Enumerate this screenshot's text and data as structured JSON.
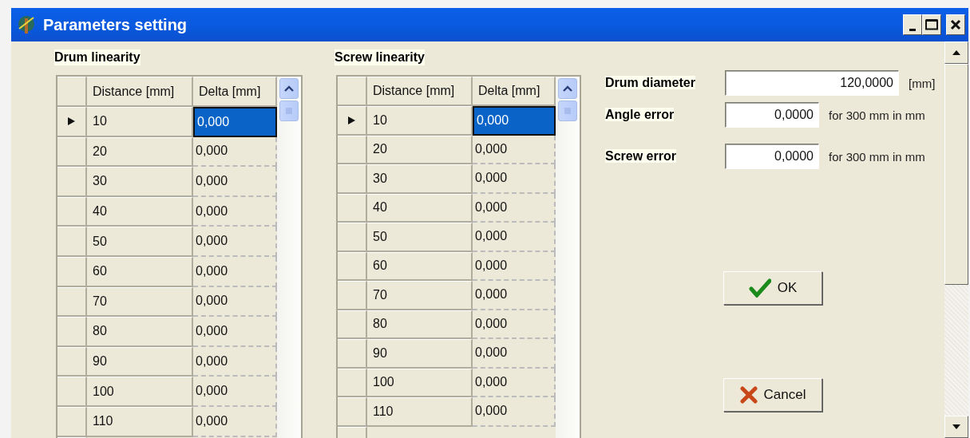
{
  "window": {
    "title": "Parameters setting"
  },
  "tables": [
    {
      "title": "Drum linearity",
      "columns": [
        "Distance [mm]",
        "Delta [mm]"
      ],
      "rows": [
        {
          "distance": "10",
          "delta": "0,000",
          "selected": true
        },
        {
          "distance": "20",
          "delta": "0,000",
          "selected": false
        },
        {
          "distance": "30",
          "delta": "0,000",
          "selected": false
        },
        {
          "distance": "40",
          "delta": "0,000",
          "selected": false
        },
        {
          "distance": "50",
          "delta": "0,000",
          "selected": false
        },
        {
          "distance": "60",
          "delta": "0,000",
          "selected": false
        },
        {
          "distance": "70",
          "delta": "0,000",
          "selected": false
        },
        {
          "distance": "80",
          "delta": "0,000",
          "selected": false
        },
        {
          "distance": "90",
          "delta": "0,000",
          "selected": false
        },
        {
          "distance": "100",
          "delta": "0,000",
          "selected": false
        },
        {
          "distance": "110",
          "delta": "0,000",
          "selected": false
        }
      ]
    },
    {
      "title": "Screw linearity",
      "columns": [
        "Distance [mm]",
        "Delta [mm]"
      ],
      "rows": [
        {
          "distance": "10",
          "delta": "0,000",
          "selected": true
        },
        {
          "distance": "20",
          "delta": "0,000",
          "selected": false
        },
        {
          "distance": "30",
          "delta": "0,000",
          "selected": false
        },
        {
          "distance": "40",
          "delta": "0,000",
          "selected": false
        },
        {
          "distance": "50",
          "delta": "0,000",
          "selected": false
        },
        {
          "distance": "60",
          "delta": "0,000",
          "selected": false
        },
        {
          "distance": "70",
          "delta": "0,000",
          "selected": false
        },
        {
          "distance": "80",
          "delta": "0,000",
          "selected": false
        },
        {
          "distance": "90",
          "delta": "0,000",
          "selected": false
        },
        {
          "distance": "100",
          "delta": "0,000",
          "selected": false
        },
        {
          "distance": "110",
          "delta": "0,000",
          "selected": false
        }
      ]
    }
  ],
  "fields": [
    {
      "label": "Drum diameter",
      "value": "120,0000",
      "unit": "[mm]"
    },
    {
      "label": "Angle error",
      "value": "0,0000",
      "unit": "for 300 mm in mm"
    },
    {
      "label": "Screw error",
      "value": "0,0000",
      "unit": "for 300 mm in mm"
    }
  ],
  "buttons": [
    {
      "kind": "ok",
      "label": "OK"
    },
    {
      "kind": "cancel",
      "label": "Cancel"
    }
  ]
}
